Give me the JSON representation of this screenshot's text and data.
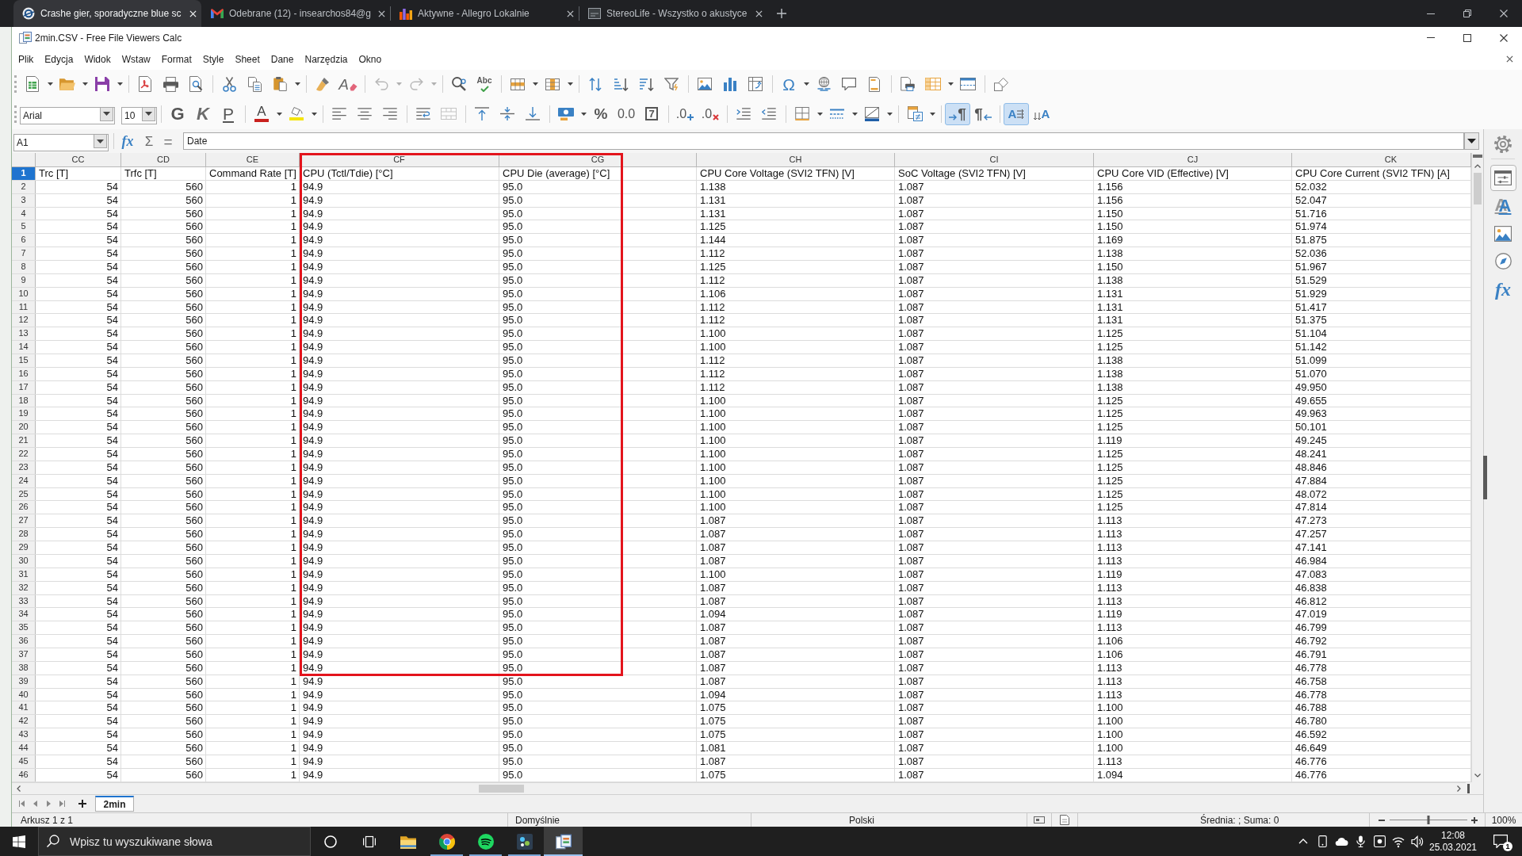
{
  "browser": {
    "tabs": [
      {
        "title": "Crashe gier, sporadyczne blue sc",
        "selected": true
      },
      {
        "title": "Odebrane (12) - insearchos84@g",
        "selected": false
      },
      {
        "title": "Aktywne - Allegro Lokalnie",
        "selected": false
      },
      {
        "title": "StereoLife - Wszystko o akustyce",
        "selected": false
      }
    ]
  },
  "window": {
    "title": "2min.CSV - Free File Viewers Calc"
  },
  "menu": [
    "Plik",
    "Edycja",
    "Widok",
    "Wstaw",
    "Format",
    "Style",
    "Sheet",
    "Dane",
    "Narzędzia",
    "Okno"
  ],
  "toolbars": {
    "standard": [
      [
        {
          "kind": "new",
          "dropdown": true,
          "disabled": false
        },
        {
          "kind": "open",
          "dropdown": true,
          "disabled": false
        },
        {
          "kind": "save",
          "dropdown": true,
          "disabled": false
        }
      ],
      [
        {
          "kind": "pdf",
          "dropdown": false,
          "disabled": false
        },
        {
          "kind": "print",
          "dropdown": false,
          "disabled": false
        },
        {
          "kind": "preview",
          "dropdown": false,
          "disabled": false
        }
      ],
      [
        {
          "kind": "cut",
          "dropdown": false,
          "disabled": false
        },
        {
          "kind": "copy",
          "dropdown": false,
          "disabled": false
        },
        {
          "kind": "paste",
          "dropdown": true,
          "disabled": false
        }
      ],
      [
        {
          "kind": "clone",
          "dropdown": false,
          "disabled": false
        },
        {
          "kind": "clear",
          "label": "A",
          "dropdown": false,
          "disabled": false
        }
      ],
      [
        {
          "kind": "undo",
          "dropdown": true,
          "disabled": true
        },
        {
          "kind": "redo",
          "dropdown": true,
          "disabled": true
        }
      ],
      [
        {
          "kind": "find",
          "dropdown": false,
          "disabled": false
        },
        {
          "kind": "spelling",
          "label": "Abc",
          "dropdown": false,
          "disabled": false
        }
      ],
      [
        {
          "kind": "row",
          "dropdown": true,
          "disabled": false
        },
        {
          "kind": "column",
          "dropdown": true,
          "disabled": false
        }
      ],
      [
        {
          "kind": "sort",
          "dropdown": false,
          "disabled": false
        },
        {
          "kind": "ascending",
          "dropdown": false,
          "disabled": false
        },
        {
          "kind": "descending",
          "dropdown": false,
          "disabled": false
        },
        {
          "kind": "filter",
          "dropdown": false,
          "disabled": false
        }
      ],
      [
        {
          "kind": "image",
          "dropdown": false,
          "disabled": false
        },
        {
          "kind": "chart",
          "dropdown": false,
          "disabled": false
        },
        {
          "kind": "pivot",
          "dropdown": false,
          "disabled": false
        }
      ],
      [
        {
          "kind": "special",
          "label": "Ω",
          "dropdown": true,
          "disabled": false
        },
        {
          "kind": "hyperlink",
          "dropdown": false,
          "disabled": false
        },
        {
          "kind": "comment",
          "dropdown": false,
          "disabled": false
        },
        {
          "kind": "headers",
          "dropdown": false,
          "disabled": false
        }
      ],
      [
        {
          "kind": "range",
          "dropdown": false,
          "disabled": false
        },
        {
          "kind": "freeze",
          "dropdown": true,
          "disabled": false
        },
        {
          "kind": "split",
          "dropdown": false,
          "disabled": false
        }
      ],
      [
        {
          "kind": "shapes",
          "dropdown": false,
          "disabled": false
        }
      ]
    ],
    "formatting": {
      "font_name": "Arial",
      "font_size": "10",
      "groups": [
        [
          {
            "kind": "bold",
            "label": "G",
            "dropdown": false,
            "disabled": false,
            "pressed": false
          },
          {
            "kind": "italic",
            "label": "K",
            "dropdown": false,
            "disabled": false,
            "pressed": false
          },
          {
            "kind": "underline",
            "label": "P",
            "dropdown": false,
            "disabled": false,
            "pressed": false
          }
        ],
        [
          {
            "kind": "fontcolor",
            "label": "A",
            "dropdown": true,
            "disabled": false,
            "pressed": false
          },
          {
            "kind": "highlight",
            "dropdown": true,
            "disabled": false,
            "pressed": false
          }
        ],
        [
          {
            "kind": "left",
            "dropdown": false,
            "disabled": false,
            "pressed": false
          },
          {
            "kind": "center",
            "dropdown": false,
            "disabled": false,
            "pressed": false
          },
          {
            "kind": "right",
            "dropdown": false,
            "disabled": false,
            "pressed": false
          }
        ],
        [
          {
            "kind": "wrap",
            "dropdown": false,
            "disabled": false,
            "pressed": false
          },
          {
            "kind": "merge",
            "dropdown": false,
            "disabled": true,
            "pressed": false
          }
        ],
        [
          {
            "kind": "top",
            "dropdown": false,
            "disabled": false,
            "pressed": false
          },
          {
            "kind": "middle",
            "dropdown": false,
            "disabled": false,
            "pressed": false
          },
          {
            "kind": "bottom",
            "dropdown": false,
            "disabled": false,
            "pressed": false
          }
        ],
        [
          {
            "kind": "currency",
            "dropdown": true,
            "disabled": false,
            "pressed": false
          },
          {
            "kind": "percent",
            "label": "%",
            "dropdown": false,
            "disabled": false,
            "pressed": false
          },
          {
            "kind": "number",
            "label": "0.0",
            "dropdown": false,
            "disabled": false,
            "pressed": false
          },
          {
            "kind": "date",
            "label": "7",
            "dropdown": false,
            "disabled": false,
            "pressed": false
          }
        ],
        [
          {
            "kind": "adddecimal",
            "label": ".0",
            "dropdown": false,
            "disabled": false,
            "pressed": false
          },
          {
            "kind": "deldecimal",
            "label": ".0",
            "dropdown": false,
            "disabled": false,
            "pressed": false
          }
        ],
        [
          {
            "kind": "indent",
            "dropdown": false,
            "disabled": false,
            "pressed": false
          },
          {
            "kind": "outdent",
            "dropdown": false,
            "disabled": false,
            "pressed": false
          }
        ],
        [
          {
            "kind": "borders",
            "dropdown": true,
            "disabled": false,
            "pressed": false
          },
          {
            "kind": "borderstyle",
            "dropdown": true,
            "disabled": false,
            "pressed": false
          },
          {
            "kind": "bordercolor",
            "dropdown": true,
            "disabled": false,
            "pressed": false
          }
        ],
        [
          {
            "kind": "conditional",
            "dropdown": true,
            "disabled": false,
            "pressed": false
          }
        ],
        [
          {
            "kind": "ltr",
            "label": "¶",
            "dropdown": false,
            "disabled": false,
            "pressed": true
          },
          {
            "kind": "rtl",
            "label": "¶",
            "dropdown": false,
            "disabled": false,
            "pressed": false
          }
        ],
        [
          {
            "kind": "textltr",
            "label": "A",
            "dropdown": false,
            "disabled": false,
            "pressed": true
          },
          {
            "kind": "vertical",
            "label": "A",
            "dropdown": false,
            "disabled": false,
            "pressed": false
          }
        ]
      ]
    }
  },
  "formula_bar": {
    "cell_reference": "A1",
    "buttons": [
      {
        "kind": "function",
        "label": "fx"
      },
      {
        "kind": "sum",
        "label": "Σ"
      },
      {
        "kind": "formula",
        "label": "="
      }
    ],
    "content": "Date"
  },
  "sidebar": {
    "tabs": [
      {
        "kind": "properties",
        "selected": true
      },
      {
        "kind": "styles",
        "label": "A",
        "selected": false
      },
      {
        "kind": "gallery",
        "selected": false
      },
      {
        "kind": "navigator",
        "selected": false
      },
      {
        "kind": "functions",
        "label": "fx",
        "selected": false
      }
    ]
  },
  "sheet": {
    "columns": [
      {
        "letter": "CC",
        "kind": "number"
      },
      {
        "letter": "CD",
        "kind": "number"
      },
      {
        "letter": "CE",
        "kind": "number"
      },
      {
        "letter": "CF",
        "kind": "text"
      },
      {
        "letter": "CG",
        "kind": "text"
      },
      {
        "letter": "CH",
        "kind": "text"
      },
      {
        "letter": "CI",
        "kind": "text"
      },
      {
        "letter": "CJ",
        "kind": "text"
      },
      {
        "letter": "CK",
        "kind": "text"
      }
    ],
    "rows": [
      {
        "number": "1",
        "kind": "labels",
        "selected": true,
        "cells": [
          "Trc [T]",
          "Trfc [T]",
          "Command Rate [T]",
          "CPU (Tctl/Tdie) [°C]",
          "CPU Die (average) [°C]",
          "CPU Core Voltage (SVI2 TFN) [V]",
          "SoC Voltage (SVI2 TFN) [V]",
          "CPU Core VID (Effective) [V]",
          "CPU Core Current (SVI2 TFN) [A]"
        ]
      },
      {
        "number": "2",
        "kind": "values",
        "selected": false,
        "cells": [
          "54",
          "560",
          "1",
          "94.9",
          "95.0",
          "1.138",
          "1.087",
          "1.156",
          "52.032"
        ]
      },
      {
        "number": "3",
        "kind": "values",
        "selected": false,
        "cells": [
          "54",
          "560",
          "1",
          "94.9",
          "95.0",
          "1.131",
          "1.087",
          "1.156",
          "52.047"
        ]
      },
      {
        "number": "4",
        "kind": "values",
        "selected": false,
        "cells": [
          "54",
          "560",
          "1",
          "94.9",
          "95.0",
          "1.131",
          "1.087",
          "1.150",
          "51.716"
        ]
      },
      {
        "number": "5",
        "kind": "values",
        "selected": false,
        "cells": [
          "54",
          "560",
          "1",
          "94.9",
          "95.0",
          "1.125",
          "1.087",
          "1.150",
          "51.974"
        ]
      },
      {
        "number": "6",
        "kind": "values",
        "selected": false,
        "cells": [
          "54",
          "560",
          "1",
          "94.9",
          "95.0",
          "1.144",
          "1.087",
          "1.169",
          "51.875"
        ]
      },
      {
        "number": "7",
        "kind": "values",
        "selected": false,
        "cells": [
          "54",
          "560",
          "1",
          "94.9",
          "95.0",
          "1.112",
          "1.087",
          "1.138",
          "52.036"
        ]
      },
      {
        "number": "8",
        "kind": "values",
        "selected": false,
        "cells": [
          "54",
          "560",
          "1",
          "94.9",
          "95.0",
          "1.125",
          "1.087",
          "1.150",
          "51.967"
        ]
      },
      {
        "number": "9",
        "kind": "values",
        "selected": false,
        "cells": [
          "54",
          "560",
          "1",
          "94.9",
          "95.0",
          "1.112",
          "1.087",
          "1.138",
          "51.529"
        ]
      },
      {
        "number": "10",
        "kind": "values",
        "selected": false,
        "cells": [
          "54",
          "560",
          "1",
          "94.9",
          "95.0",
          "1.106",
          "1.087",
          "1.131",
          "51.929"
        ]
      },
      {
        "number": "11",
        "kind": "values",
        "selected": false,
        "cells": [
          "54",
          "560",
          "1",
          "94.9",
          "95.0",
          "1.112",
          "1.087",
          "1.131",
          "51.417"
        ]
      },
      {
        "number": "12",
        "kind": "values",
        "selected": false,
        "cells": [
          "54",
          "560",
          "1",
          "94.9",
          "95.0",
          "1.112",
          "1.087",
          "1.131",
          "51.375"
        ]
      },
      {
        "number": "13",
        "kind": "values",
        "selected": false,
        "cells": [
          "54",
          "560",
          "1",
          "94.9",
          "95.0",
          "1.100",
          "1.087",
          "1.125",
          "51.104"
        ]
      },
      {
        "number": "14",
        "kind": "values",
        "selected": false,
        "cells": [
          "54",
          "560",
          "1",
          "94.9",
          "95.0",
          "1.100",
          "1.087",
          "1.125",
          "51.142"
        ]
      },
      {
        "number": "15",
        "kind": "values",
        "selected": false,
        "cells": [
          "54",
          "560",
          "1",
          "94.9",
          "95.0",
          "1.112",
          "1.087",
          "1.138",
          "51.099"
        ]
      },
      {
        "number": "16",
        "kind": "values",
        "selected": false,
        "cells": [
          "54",
          "560",
          "1",
          "94.9",
          "95.0",
          "1.112",
          "1.087",
          "1.138",
          "51.070"
        ]
      },
      {
        "number": "17",
        "kind": "values",
        "selected": false,
        "cells": [
          "54",
          "560",
          "1",
          "94.9",
          "95.0",
          "1.112",
          "1.087",
          "1.138",
          "49.950"
        ]
      },
      {
        "number": "18",
        "kind": "values",
        "selected": false,
        "cells": [
          "54",
          "560",
          "1",
          "94.9",
          "95.0",
          "1.100",
          "1.087",
          "1.125",
          "49.655"
        ]
      },
      {
        "number": "19",
        "kind": "values",
        "selected": false,
        "cells": [
          "54",
          "560",
          "1",
          "94.9",
          "95.0",
          "1.100",
          "1.087",
          "1.125",
          "49.963"
        ]
      },
      {
        "number": "20",
        "kind": "values",
        "selected": false,
        "cells": [
          "54",
          "560",
          "1",
          "94.9",
          "95.0",
          "1.100",
          "1.087",
          "1.125",
          "50.101"
        ]
      },
      {
        "number": "21",
        "kind": "values",
        "selected": false,
        "cells": [
          "54",
          "560",
          "1",
          "94.9",
          "95.0",
          "1.100",
          "1.087",
          "1.119",
          "49.245"
        ]
      },
      {
        "number": "22",
        "kind": "values",
        "selected": false,
        "cells": [
          "54",
          "560",
          "1",
          "94.9",
          "95.0",
          "1.100",
          "1.087",
          "1.125",
          "48.241"
        ]
      },
      {
        "number": "23",
        "kind": "values",
        "selected": false,
        "cells": [
          "54",
          "560",
          "1",
          "94.9",
          "95.0",
          "1.100",
          "1.087",
          "1.125",
          "48.846"
        ]
      },
      {
        "number": "24",
        "kind": "values",
        "selected": false,
        "cells": [
          "54",
          "560",
          "1",
          "94.9",
          "95.0",
          "1.100",
          "1.087",
          "1.125",
          "47.884"
        ]
      },
      {
        "number": "25",
        "kind": "values",
        "selected": false,
        "cells": [
          "54",
          "560",
          "1",
          "94.9",
          "95.0",
          "1.100",
          "1.087",
          "1.125",
          "48.072"
        ]
      },
      {
        "number": "26",
        "kind": "values",
        "selected": false,
        "cells": [
          "54",
          "560",
          "1",
          "94.9",
          "95.0",
          "1.100",
          "1.087",
          "1.125",
          "47.814"
        ]
      },
      {
        "number": "27",
        "kind": "values",
        "selected": false,
        "cells": [
          "54",
          "560",
          "1",
          "94.9",
          "95.0",
          "1.087",
          "1.087",
          "1.113",
          "47.273"
        ]
      },
      {
        "number": "28",
        "kind": "values",
        "selected": false,
        "cells": [
          "54",
          "560",
          "1",
          "94.9",
          "95.0",
          "1.087",
          "1.087",
          "1.113",
          "47.257"
        ]
      },
      {
        "number": "29",
        "kind": "values",
        "selected": false,
        "cells": [
          "54",
          "560",
          "1",
          "94.9",
          "95.0",
          "1.087",
          "1.087",
          "1.113",
          "47.141"
        ]
      },
      {
        "number": "30",
        "kind": "values",
        "selected": false,
        "cells": [
          "54",
          "560",
          "1",
          "94.9",
          "95.0",
          "1.087",
          "1.087",
          "1.113",
          "46.984"
        ]
      },
      {
        "number": "31",
        "kind": "values",
        "selected": false,
        "cells": [
          "54",
          "560",
          "1",
          "94.9",
          "95.0",
          "1.100",
          "1.087",
          "1.119",
          "47.083"
        ]
      },
      {
        "number": "32",
        "kind": "values",
        "selected": false,
        "cells": [
          "54",
          "560",
          "1",
          "94.9",
          "95.0",
          "1.087",
          "1.087",
          "1.113",
          "46.838"
        ]
      },
      {
        "number": "33",
        "kind": "values",
        "selected": false,
        "cells": [
          "54",
          "560",
          "1",
          "94.9",
          "95.0",
          "1.087",
          "1.087",
          "1.113",
          "46.812"
        ]
      },
      {
        "number": "34",
        "kind": "values",
        "selected": false,
        "cells": [
          "54",
          "560",
          "1",
          "94.9",
          "95.0",
          "1.094",
          "1.087",
          "1.119",
          "47.019"
        ]
      },
      {
        "number": "35",
        "kind": "values",
        "selected": false,
        "cells": [
          "54",
          "560",
          "1",
          "94.9",
          "95.0",
          "1.087",
          "1.087",
          "1.113",
          "46.799"
        ]
      },
      {
        "number": "36",
        "kind": "values",
        "selected": false,
        "cells": [
          "54",
          "560",
          "1",
          "94.9",
          "95.0",
          "1.087",
          "1.087",
          "1.106",
          "46.792"
        ]
      },
      {
        "number": "37",
        "kind": "values",
        "selected": false,
        "cells": [
          "54",
          "560",
          "1",
          "94.9",
          "95.0",
          "1.087",
          "1.087",
          "1.106",
          "46.791"
        ]
      },
      {
        "number": "38",
        "kind": "values",
        "selected": false,
        "cells": [
          "54",
          "560",
          "1",
          "94.9",
          "95.0",
          "1.087",
          "1.087",
          "1.113",
          "46.778"
        ]
      },
      {
        "number": "39",
        "kind": "values",
        "selected": false,
        "cells": [
          "54",
          "560",
          "1",
          "94.9",
          "95.0",
          "1.087",
          "1.087",
          "1.113",
          "46.758"
        ]
      },
      {
        "number": "40",
        "kind": "values",
        "selected": false,
        "cells": [
          "54",
          "560",
          "1",
          "94.9",
          "95.0",
          "1.094",
          "1.087",
          "1.113",
          "46.778"
        ]
      },
      {
        "number": "41",
        "kind": "values",
        "selected": false,
        "cells": [
          "54",
          "560",
          "1",
          "94.9",
          "95.0",
          "1.075",
          "1.087",
          "1.100",
          "46.788"
        ]
      },
      {
        "number": "42",
        "kind": "values",
        "selected": false,
        "cells": [
          "54",
          "560",
          "1",
          "94.9",
          "95.0",
          "1.075",
          "1.087",
          "1.100",
          "46.780"
        ]
      },
      {
        "number": "43",
        "kind": "values",
        "selected": false,
        "cells": [
          "54",
          "560",
          "1",
          "94.9",
          "95.0",
          "1.075",
          "1.087",
          "1.100",
          "46.592"
        ]
      },
      {
        "number": "44",
        "kind": "values",
        "selected": false,
        "cells": [
          "54",
          "560",
          "1",
          "94.9",
          "95.0",
          "1.081",
          "1.087",
          "1.100",
          "46.649"
        ]
      },
      {
        "number": "45",
        "kind": "values",
        "selected": false,
        "cells": [
          "54",
          "560",
          "1",
          "94.9",
          "95.0",
          "1.087",
          "1.087",
          "1.113",
          "46.776"
        ]
      },
      {
        "number": "46",
        "kind": "values",
        "selected": false,
        "cells": [
          "54",
          "560",
          "1",
          "94.9",
          "95.0",
          "1.075",
          "1.087",
          "1.094",
          "46.776"
        ]
      }
    ]
  },
  "sheet_tabs": [
    {
      "name": "2min",
      "selected": true
    }
  ],
  "status_bar": {
    "sheet_position": "Arkusz 1 z 1",
    "page_style": "Domyślnie",
    "language": "Polski",
    "summary": "Średnia: ; Suma: 0",
    "zoom_slider": {
      "level": 0.5
    },
    "zoom": "100%"
  },
  "taskbar": {
    "search": {
      "placeholder": "Wpisz tu wyszukiwane słowa"
    },
    "apps": [
      {
        "kind": "explorer",
        "running": false,
        "selected": false
      },
      {
        "kind": "browser",
        "running": true,
        "selected": false
      },
      {
        "kind": "music",
        "running": true,
        "selected": false
      },
      {
        "kind": "tool",
        "running": true,
        "selected": false
      },
      {
        "kind": "viewer",
        "running": true,
        "selected": true
      }
    ],
    "clock": {
      "time": "12:08",
      "date": "25.03.2021"
    },
    "notification_count": "1"
  }
}
